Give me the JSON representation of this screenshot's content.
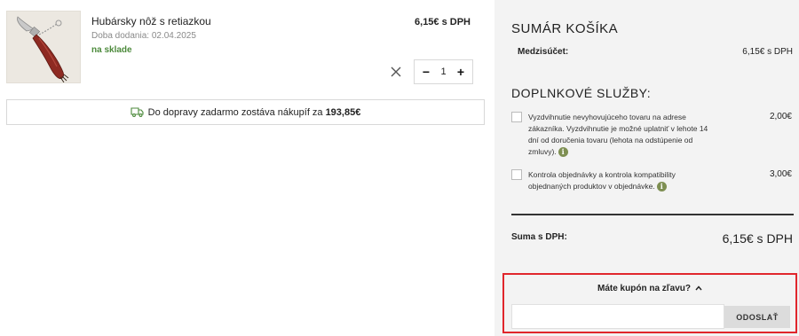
{
  "cart_item": {
    "name": "Hubársky nôž s retiazkou",
    "delivery": "Doba dodania: 02.04.2025",
    "stock": "na sklade",
    "price": "6,15€ s DPH",
    "quantity": "1",
    "qty_minus": "−",
    "qty_plus": "+"
  },
  "shipping": {
    "text": "Do dopravy zadarmo zostáva nákupíf za",
    "amount": "193,85€"
  },
  "summary": {
    "title": "SUMÁR KOŠÍKA",
    "subtotal_label": "Medzisúčet:",
    "subtotal_value": "6,15€ s DPH",
    "services_title": "DOPLNKOVÉ SLUŽBY:",
    "services": [
      {
        "description": "Vyzdvihnutie nevyhovujúceho tovaru na adrese zákazníka. Vyzdvihnutie je možné uplatniť v lehote 14 dní od doručenia tovaru (lehota na odstúpenie od zmluvy).",
        "price": "2,00€",
        "checked": false
      },
      {
        "description": "Kontrola objednávky a kontrola kompatibility objednaných produktov v objednávke.",
        "price": "3,00€",
        "checked": false
      }
    ],
    "total_label": "Suma s DPH:",
    "total_value": "6,15€ s DPH"
  },
  "coupon": {
    "toggle_label": "Máte kupón na zľavu?",
    "input_value": "",
    "submit_label": "ODOSLAŤ"
  },
  "colors": {
    "in_stock": "#4c8a3b",
    "info_icon": "#7e8f52",
    "coupon_highlight": "#e0262c",
    "sidebar_bg": "#f3f3f3"
  }
}
